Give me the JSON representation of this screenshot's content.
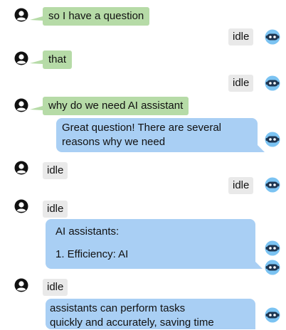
{
  "messages": {
    "m1": "so I have a question",
    "m2": "idle",
    "m3": "that",
    "m4": "idle",
    "m5": "why do we need AI assistant",
    "m6_line1": "Great question! There are several",
    "m6_line2": "reasons why we need",
    "m7": "idle",
    "m8": "idle",
    "m9": "idle",
    "m10_line1": "AI assistants:",
    "m10_line2": "1. Efficiency: AI",
    "m11": "idle",
    "m12_line1": "assistants can perform tasks",
    "m12_line2": "quickly and accurately, saving time"
  },
  "icons": {
    "user": "user-avatar-icon",
    "bot": "robot-avatar-icon"
  },
  "colors": {
    "user_bubble": "#b6dba7",
    "bot_bubble": "#a9cff4",
    "idle_bubble": "#e9e9e9",
    "bot_avatar": "#7bc3f2",
    "user_avatar": "#111111"
  }
}
